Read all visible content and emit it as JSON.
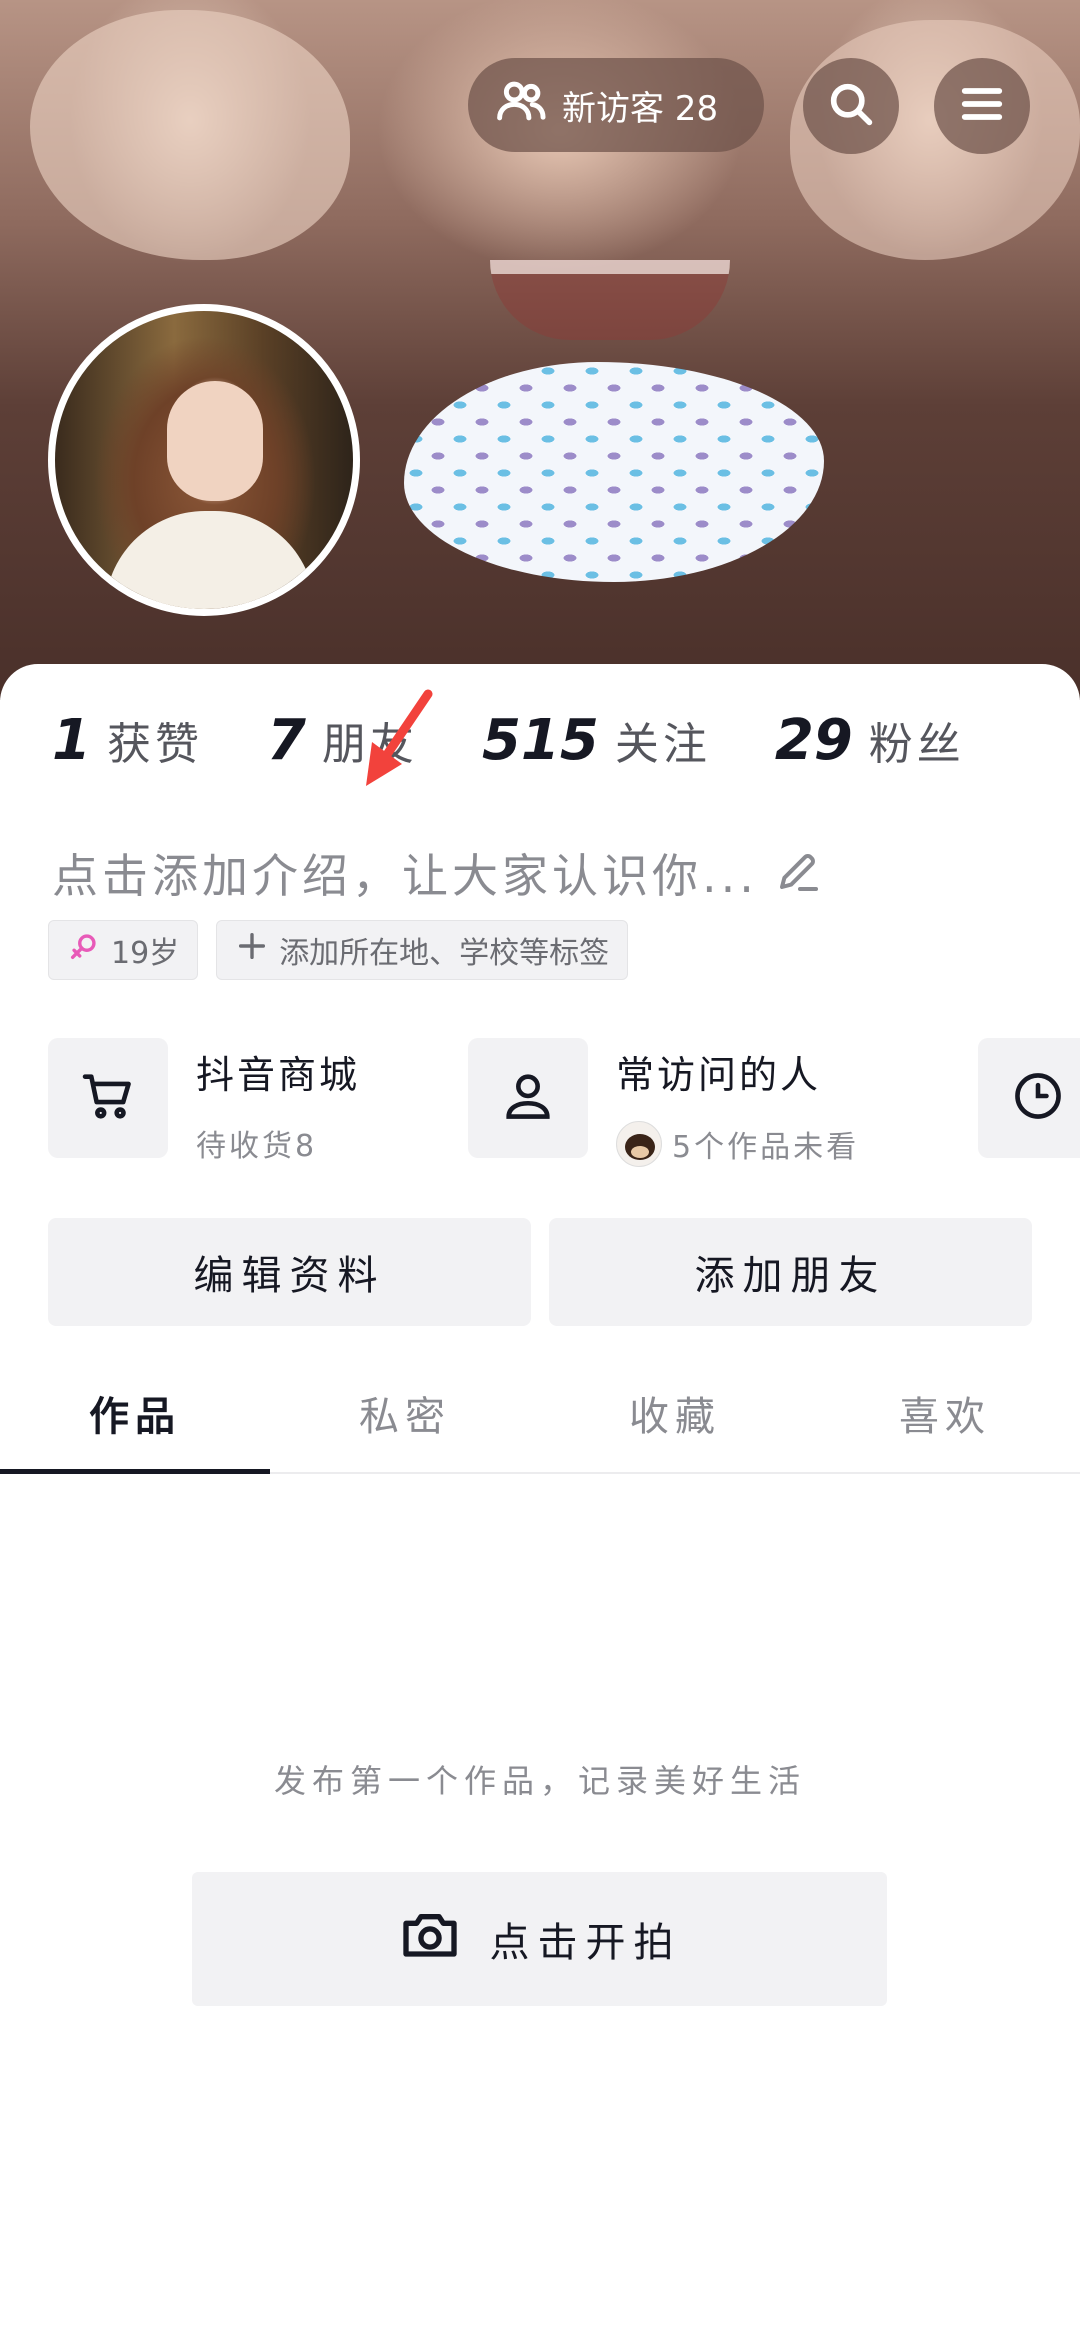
{
  "header": {
    "visitor_label": "新访客 28",
    "icons": [
      "visitors-icon",
      "search-icon",
      "menu-icon"
    ]
  },
  "stats": [
    {
      "num": "1",
      "label": "获赞"
    },
    {
      "num": "7",
      "label": "朋友"
    },
    {
      "num": "515",
      "label": "关注"
    },
    {
      "num": "29",
      "label": "粉丝"
    }
  ],
  "bio": {
    "placeholder": "点击添加介绍，让大家认识你..."
  },
  "tags": {
    "age": "19岁",
    "add": "添加所在地、学校等标签"
  },
  "shortcuts": [
    {
      "title": "抖音商城",
      "subtitle": "待收货8",
      "icon": "cart-icon"
    },
    {
      "title": "常访问的人",
      "subtitle": "5个作品未看",
      "icon": "person-icon"
    },
    {
      "icon": "clock-icon"
    }
  ],
  "actions": {
    "edit": "编辑资料",
    "add_friend": "添加朋友"
  },
  "tabs": [
    "作品",
    "私密",
    "收藏",
    "喜欢"
  ],
  "empty": {
    "text": "发布第一个作品，记录美好生活",
    "button": "点击开拍"
  },
  "colors": {
    "accent_arrow": "#f2423c",
    "gender_female": "#e85ab8",
    "text_primary": "#161823",
    "text_secondary": "#8a8b91"
  }
}
